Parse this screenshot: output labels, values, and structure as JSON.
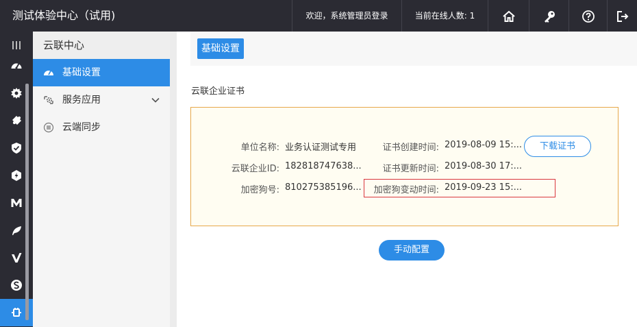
{
  "header": {
    "app_title": "测试体验中心（试用)",
    "welcome": "欢迎，系统管理员登录",
    "online_users": "当前在线人数: 1"
  },
  "subnav": {
    "title": "云联中心",
    "items": [
      {
        "label": "基础设置",
        "icon": "dashboard-icon"
      },
      {
        "label": "服务应用",
        "icon": "service-gear-icon"
      },
      {
        "label": "云端同步",
        "icon": "sync-list-icon"
      }
    ]
  },
  "main": {
    "tab_label": "基础设置",
    "section_title": "云联企业证书",
    "fields": {
      "org_name_label": "单位名称:",
      "org_name_value": "业务认证测试专用",
      "enterprise_id_label": "云联企业ID:",
      "enterprise_id_value": "182818747638...",
      "dongle_label": "加密狗号:",
      "dongle_value": "810275385196...",
      "created_label": "证书创建时间:",
      "created_value": "2019-08-09 15:...",
      "updated_label": "证书更新时间:",
      "updated_value": "2019-08-30 17:...",
      "dongle_change_label": "加密狗变动时间:",
      "dongle_change_value": "2019-09-23 15:..."
    },
    "download_button": "下载证书",
    "manual_button": "手动配置"
  },
  "colors": {
    "accent": "#2d8ce6",
    "topbar": "#2b2b33",
    "box_border": "#e6a84a",
    "highlight_border": "#d9363e"
  }
}
